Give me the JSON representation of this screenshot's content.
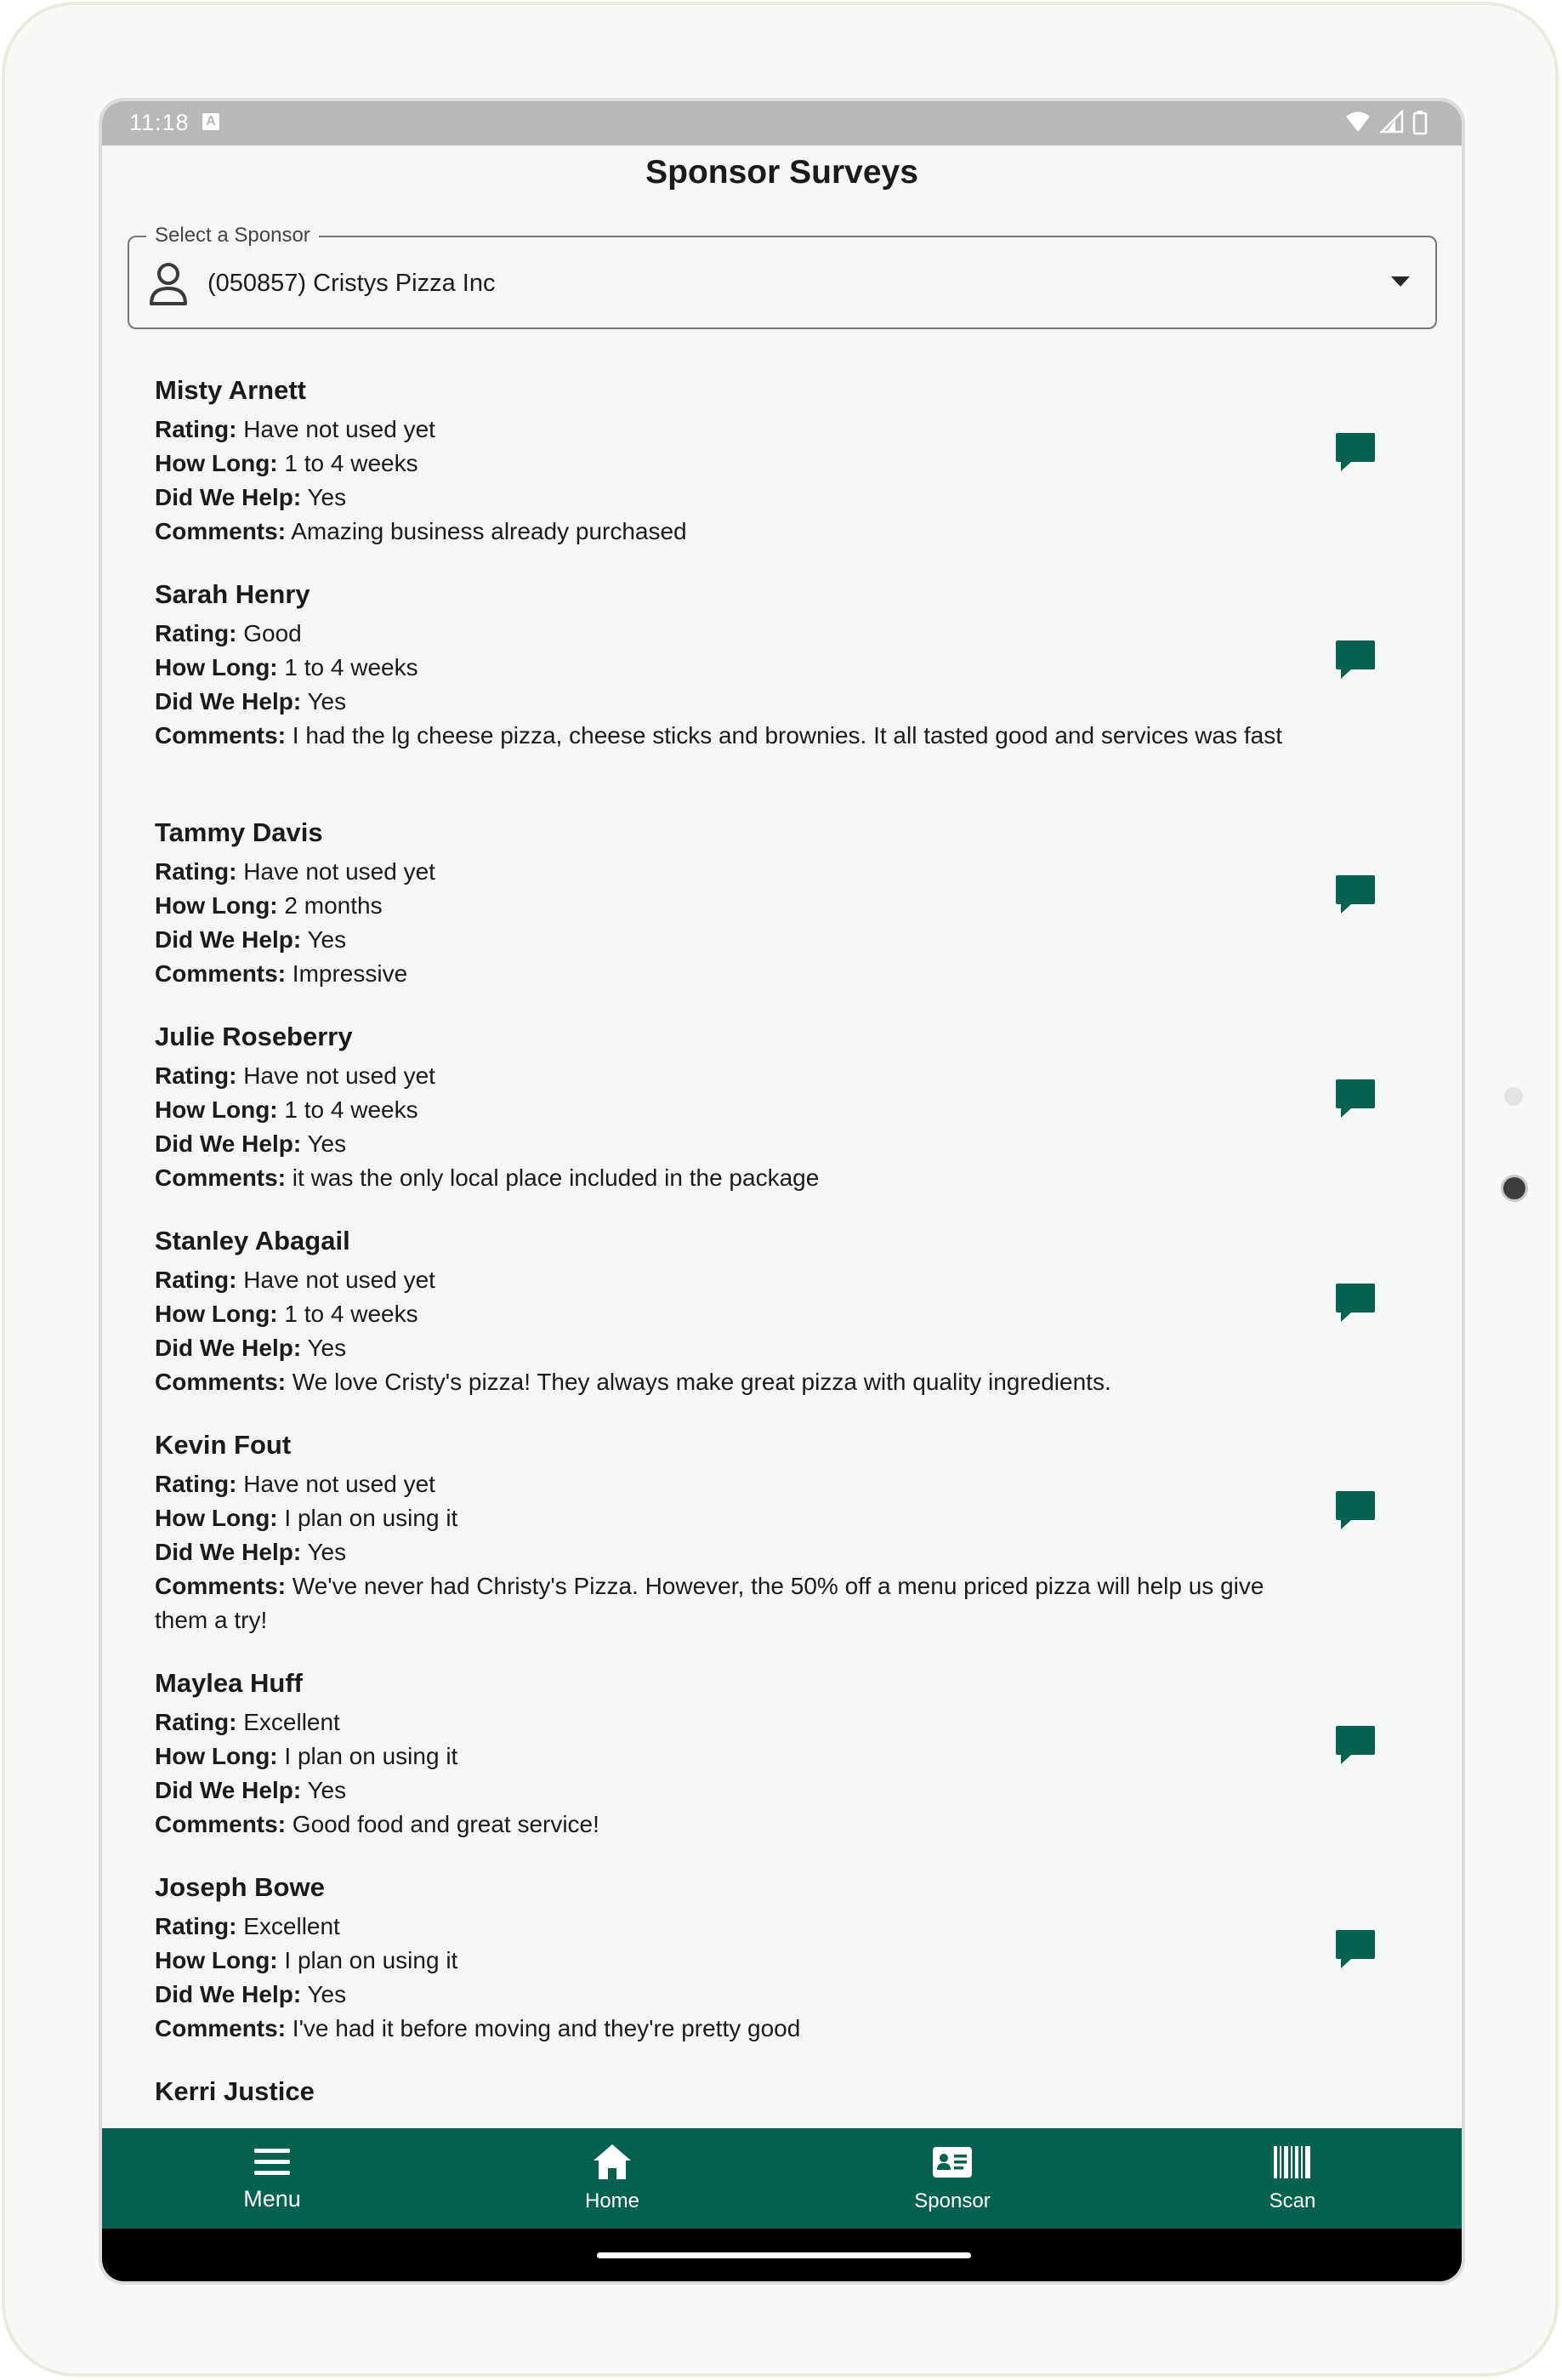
{
  "status_bar": {
    "time": "11:18",
    "notification_glyph": "A"
  },
  "header": {
    "title": "Sponsor Surveys"
  },
  "sponsor_select": {
    "label": "Select a Sponsor",
    "value": "(050857) Cristys Pizza Inc"
  },
  "field_labels": {
    "rating": "Rating:",
    "how_long": "How Long:",
    "did_we_help": "Did We Help:",
    "comments": "Comments:"
  },
  "surveys": [
    {
      "name": "Misty Arnett",
      "rating": "Have not used yet",
      "how_long": "1 to 4 weeks",
      "did_we_help": "Yes",
      "comments": "Amazing business already purchased"
    },
    {
      "name": "Sarah Henry",
      "rating": "Good",
      "how_long": "1 to 4 weeks",
      "did_we_help": "Yes",
      "comments": "I had the lg cheese pizza, cheese sticks and brownies. It all tasted good and services was fast"
    },
    {
      "name": "Tammy Davis",
      "rating": "Have not used yet",
      "how_long": "2 months",
      "did_we_help": "Yes",
      "comments": "Impressive"
    },
    {
      "name": "Julie Roseberry",
      "rating": "Have not used yet",
      "how_long": "1 to 4 weeks",
      "did_we_help": "Yes",
      "comments": "it was the only local place included in the package"
    },
    {
      "name": "Stanley Abagail",
      "rating": "Have not used yet",
      "how_long": "1 to 4 weeks",
      "did_we_help": "Yes",
      "comments": "We love Cristy's pizza! They always make great pizza with quality ingredients."
    },
    {
      "name": "Kevin Fout",
      "rating": "Have not used yet",
      "how_long": "I plan on using it",
      "did_we_help": "Yes",
      "comments": "We've never had Christy's Pizza. However, the 50% off a menu priced pizza will help us give them a try!"
    },
    {
      "name": "Maylea Huff",
      "rating": "Excellent",
      "how_long": "I plan on using it",
      "did_we_help": "Yes",
      "comments": "Good food and great service!"
    },
    {
      "name": "Joseph Bowe",
      "rating": "Excellent",
      "how_long": "I plan on using it",
      "did_we_help": "Yes",
      "comments": "I've had it before moving and they're pretty good"
    },
    {
      "name": "Kerri Justice"
    }
  ],
  "bottom_nav": {
    "menu": "Menu",
    "home": "Home",
    "sponsor": "Sponsor",
    "scan": "Scan"
  },
  "colors": {
    "primary": "#066150",
    "background": "#f4f7f6"
  }
}
